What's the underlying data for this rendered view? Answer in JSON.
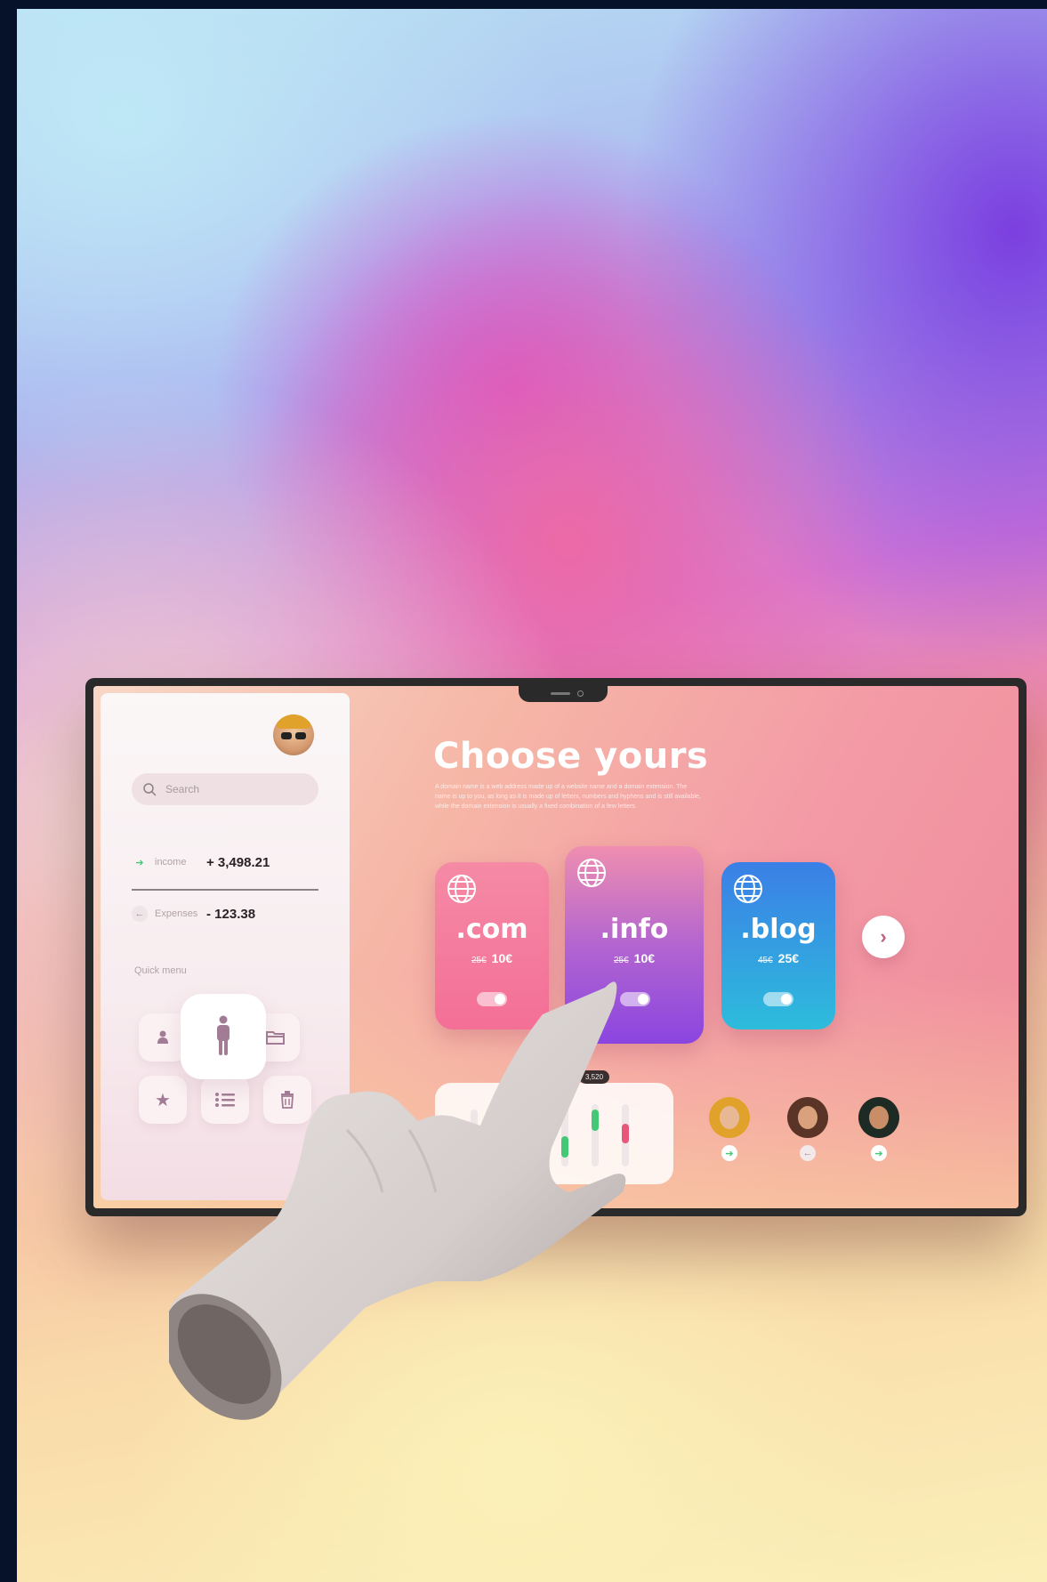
{
  "main": {
    "title": "Choose yours",
    "description": "A domain name is a web address made up of a website name and a domain extension. The name is up to you, as long as it is made up of letters, numbers and hyphens and is still available, while the domain extension is usually a fixed combination of a few letters."
  },
  "sidebar": {
    "search_placeholder": "Search",
    "income": {
      "label": "income",
      "value": "+ 3,498.21"
    },
    "expenses": {
      "label": "Expenses",
      "value": "- 123.38"
    },
    "quick_menu_label": "Quick menu",
    "quick_menu_icons": [
      "user-icon",
      "person-standing-icon",
      "folder-icon",
      "star-icon",
      "list-icon",
      "trash-icon"
    ]
  },
  "domains": [
    {
      "ext": ".com",
      "old_price": "25€",
      "price": "10€",
      "toggle_on": true,
      "color": "#f57aa0"
    },
    {
      "ext": ".info",
      "old_price": "25€",
      "price": "10€",
      "toggle_on": true,
      "color": "#9b4fd8"
    },
    {
      "ext": ".blog",
      "old_price": "45€",
      "price": "25€",
      "toggle_on": true,
      "color": "#2f8be0"
    }
  ],
  "chart": {
    "tooltip": "3,520"
  },
  "colors": {
    "accent_green": "#43c976",
    "accent_pink": "#e8567a",
    "frame": "#2a2a2a"
  }
}
